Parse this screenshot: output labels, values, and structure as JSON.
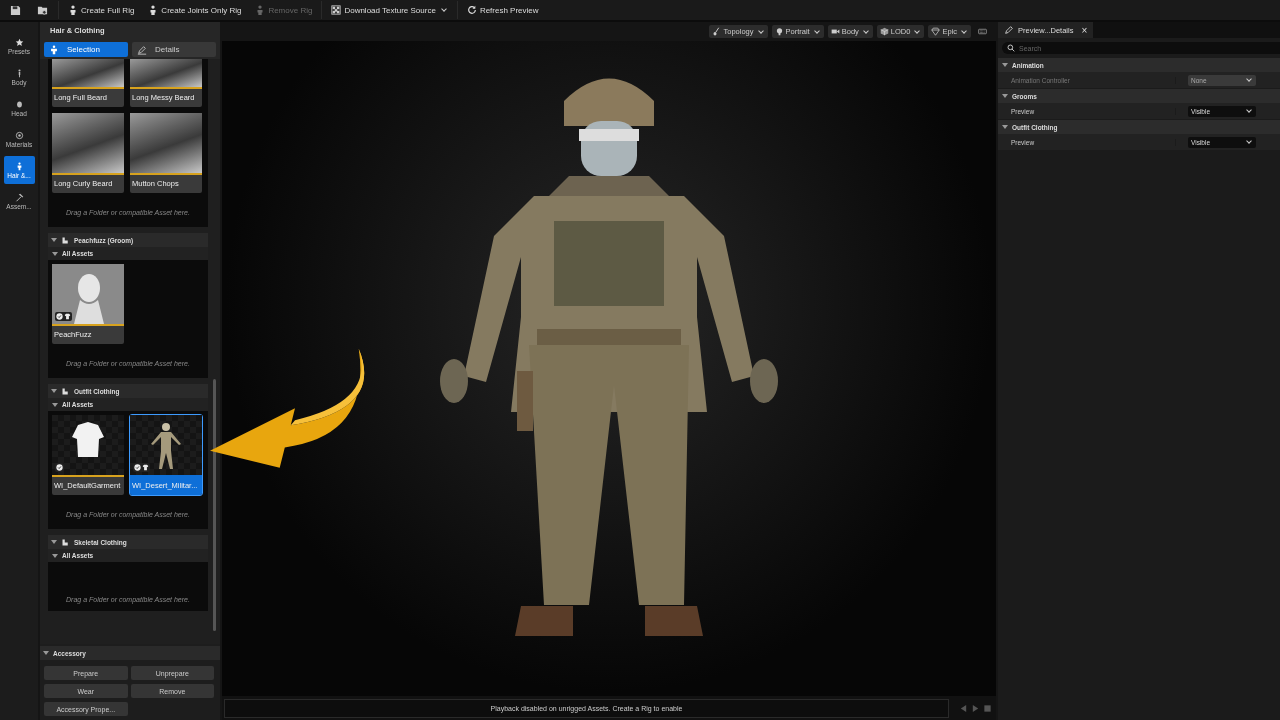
{
  "toolbar": [
    {
      "kind": "save"
    },
    {
      "kind": "browse"
    },
    {
      "kind": "rig",
      "label": "Create Full Rig",
      "disabled": false
    },
    {
      "kind": "rig",
      "label": "Create Joints Only Rig",
      "disabled": false
    },
    {
      "kind": "rig",
      "label": "Remove Rig",
      "disabled": true
    },
    {
      "kind": "texture",
      "label": "Download Texture Source",
      "disabled": false
    },
    {
      "kind": "refresh",
      "label": "Refresh Preview",
      "disabled": false
    }
  ],
  "rail": [
    {
      "kind": "star",
      "label": "Presets",
      "selected": false
    },
    {
      "kind": "body",
      "label": "Body",
      "selected": false
    },
    {
      "kind": "head",
      "label": "Head",
      "selected": false
    },
    {
      "kind": "materials",
      "label": "Materials",
      "selected": false
    },
    {
      "kind": "hair",
      "label": "Hair &...",
      "selected": true
    },
    {
      "kind": "hammer",
      "label": "Assem...",
      "selected": false
    }
  ],
  "panel": {
    "title": "Hair & Clothing",
    "tabs": [
      {
        "kind": "selection",
        "label": "Selection",
        "selected": true
      },
      {
        "kind": "details",
        "label": "Details",
        "selected": false
      }
    ],
    "sections": [
      {
        "assets": [
          {
            "kind": "photo",
            "name": "Long Full Beard",
            "selected": false
          },
          {
            "kind": "photo",
            "name": "Long Messy Beard",
            "selected": false
          },
          {
            "kind": "photo",
            "name": "Long Curly Beard",
            "selected": false
          },
          {
            "kind": "photo",
            "name": "Mutton Chops",
            "selected": false
          }
        ],
        "hint": "Drag a Folder or compatible Asset here."
      },
      {
        "title": "Peachfuzz (Groom)",
        "group": "All Assets",
        "assets": [
          {
            "kind": "head",
            "name": "PeachFuzz",
            "selected": false,
            "checked": true,
            "clothing": true
          }
        ],
        "hint": "Drag a Folder or compatible Asset here."
      },
      {
        "title": "Outfit Clothing",
        "group": "All Assets",
        "assets": [
          {
            "kind": "shirt",
            "name": "WI_DefaultGarment",
            "selected": false,
            "checked": true,
            "clothing": false
          },
          {
            "kind": "soldier",
            "name": "WI_Desert_Militar...",
            "selected": true,
            "checked": true,
            "clothing": true
          }
        ],
        "hint": "Drag a Folder or compatible Asset here."
      },
      {
        "title": "Skeletal Clothing",
        "group": "All Assets",
        "hint": "Drag a Folder or compatible Asset here."
      }
    ],
    "accessory": {
      "title": "Accessory",
      "buttons": [
        "Prepare",
        "Unprepare",
        "Wear",
        "Remove",
        "Accessory Prope..."
      ]
    }
  },
  "viewport": {
    "controls": [
      {
        "kind": "topology",
        "label": "Topology"
      },
      {
        "kind": "portrait",
        "label": "Portrait"
      },
      {
        "kind": "camera",
        "label": "Body"
      },
      {
        "kind": "cube",
        "label": "LOD0"
      },
      {
        "kind": "gem",
        "label": "Epic"
      },
      {
        "kind": "keyboard"
      }
    ],
    "status": "Playback disabled on unrigged Assets. Create a Rig to enable"
  },
  "details": {
    "tab": "Preview...Details",
    "close": "×",
    "search": {
      "placeholder": "Search"
    },
    "categories": [
      {
        "title": "Animation",
        "expanded": true,
        "rows": [
          {
            "label": "Animation Controller",
            "value": "None",
            "disabled": true
          }
        ]
      },
      {
        "title": "Grooms",
        "expanded": true,
        "rows": [
          {
            "label": "Preview",
            "value": "Visible",
            "disabled": false
          }
        ]
      },
      {
        "title": "Outfit Clothing",
        "expanded": true,
        "rows": [
          {
            "label": "Preview",
            "value": "Visible",
            "disabled": false
          }
        ]
      }
    ]
  }
}
